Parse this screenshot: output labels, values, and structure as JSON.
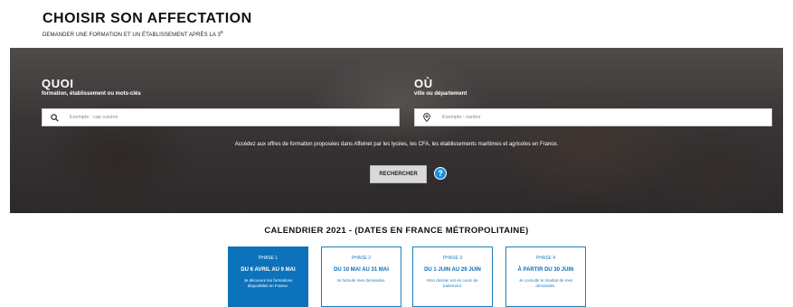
{
  "header": {
    "title": "CHOISIR SON AFFECTATION",
    "subtitle": "DEMANDER UNE FORMATION ET UN ÉTABLISSEMENT APRÈS LA 3",
    "subtitle_sup": "E"
  },
  "search": {
    "what_title": "QUOI",
    "what_subtitle": "formation, établissement ou mots-clés",
    "what_placeholder": "Exemple : cap cuisine",
    "what_icon": "search-icon",
    "where_title": "OÙ",
    "where_subtitle": "ville ou département",
    "where_placeholder": "Exemple : nantes",
    "where_icon": "location-pin-icon",
    "info": "Accédez aux offres de formation proposées dans Affelnet par les lycées, les CFA, les établissements maritimes et agricoles en France.",
    "button_label": "RECHERCHER",
    "help_label": "?"
  },
  "calendar": {
    "title": "CALENDRIER 2021 - (DATES EN FRANCE MÉTROPOLITAINE)",
    "phases": [
      {
        "name": "PHASE 1",
        "dates": "DU 6 AVRIL AU 9 MAI",
        "desc": "Je découvre les formations disponibles en France."
      },
      {
        "name": "PHASE 2",
        "dates": "DU 10 MAI AU 31 MAI",
        "desc": "Je formule mes demandes."
      },
      {
        "name": "PHASE 3",
        "dates": "DU 1 JUIN AU 29 JUIN",
        "desc": "Mon dossier est en cours de traitement."
      },
      {
        "name": "PHASE 4",
        "dates": "À PARTIR DU 30 JUIN",
        "desc": "Je consulte le résultat de mes demandes."
      }
    ],
    "active_phase": "PHASE 1"
  },
  "colors": {
    "accent_blue": "#0c72bb",
    "help_blue": "#1b8fe0"
  }
}
